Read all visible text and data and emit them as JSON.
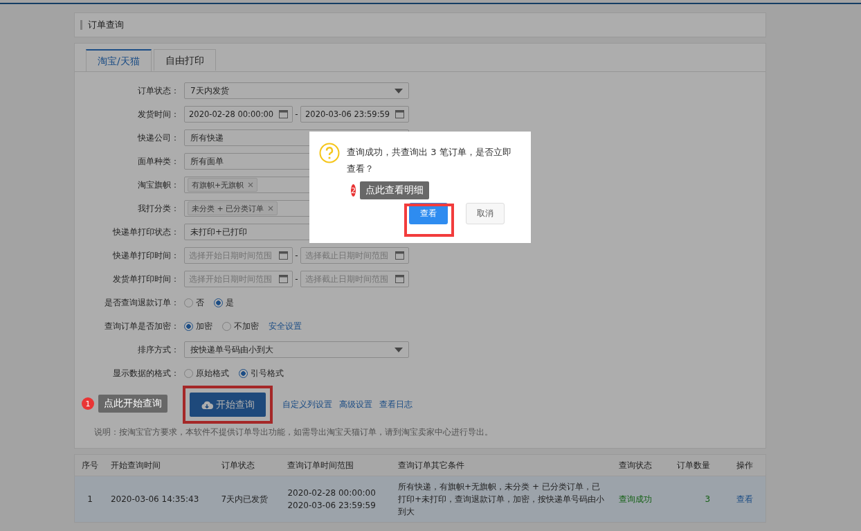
{
  "page_title": "订单查询",
  "tabs": [
    {
      "label": "淘宝/天猫",
      "selected": true
    },
    {
      "label": "自由打印",
      "selected": false
    }
  ],
  "form": {
    "rows": [
      {
        "label": "订单状态：",
        "kind": "select",
        "value": "7天内发货"
      },
      {
        "label": "发货时间：",
        "kind": "date_range",
        "start": {
          "value": "2020-02-28 00:00:00"
        },
        "separator": "-",
        "end": {
          "value": "2020-03-06 23:59:59"
        }
      },
      {
        "label": "快递公司：",
        "kind": "select",
        "value": "所有快递"
      },
      {
        "label": "面单种类：",
        "kind": "select",
        "value": "所有面单"
      },
      {
        "label": "淘宝旗帜：",
        "kind": "tags",
        "tags": [
          "有旗帜+无旗帜"
        ]
      },
      {
        "label": "我打分类：",
        "kind": "tags",
        "tags": [
          "未分类 + 已分类订单"
        ]
      },
      {
        "label": "快递单打印状态：",
        "kind": "select",
        "value": "未打印+已打印"
      },
      {
        "label": "快递单打印时间：",
        "kind": "date_range",
        "start": {
          "placeholder": "选择开始日期时间范围"
        },
        "separator": "-",
        "end": {
          "placeholder": "选择截止日期时间范围"
        }
      },
      {
        "label": "发货单打印时间：",
        "kind": "date_range",
        "start": {
          "placeholder": "选择开始日期时间范围"
        },
        "separator": "-",
        "end": {
          "placeholder": "选择截止日期时间范围"
        }
      },
      {
        "label": "是否查询退款订单：",
        "kind": "radio",
        "options": [
          {
            "label": "否",
            "selected": false
          },
          {
            "label": "是",
            "selected": true
          }
        ]
      },
      {
        "label": "查询订单是否加密：",
        "kind": "radio",
        "options": [
          {
            "label": "加密",
            "selected": true
          },
          {
            "label": "不加密",
            "selected": false
          }
        ],
        "link": "安全设置"
      },
      {
        "label": "排序方式：",
        "kind": "select",
        "value": "按快递单号码由小到大"
      },
      {
        "label": "显示数据的格式：",
        "kind": "radio",
        "options": [
          {
            "label": "原始格式",
            "selected": false
          },
          {
            "label": "引号格式",
            "selected": true
          }
        ]
      }
    ],
    "search_button": "开始查询",
    "links": [
      "自定义列设置",
      "高级设置",
      "查看日志"
    ],
    "note": "说明：按淘宝官方要求，本软件不提供订单导出功能，如需导出淘宝天猫订单，请到淘宝卖家中心进行导出。"
  },
  "table": {
    "columns": [
      {
        "label": "序号",
        "kind": "index"
      },
      {
        "label": "开始查询时间",
        "kind": "text"
      },
      {
        "label": "订单状态",
        "kind": "text"
      },
      {
        "label": "查询订单时间范围",
        "kind": "text"
      },
      {
        "label": "查询订单其它条件",
        "kind": "text"
      },
      {
        "label": "查询状态",
        "kind": "success"
      },
      {
        "label": "订单数量",
        "kind": "number"
      },
      {
        "label": "操作",
        "kind": "link"
      }
    ],
    "rows": [
      {
        "selected": true,
        "cells": [
          "1",
          "2020-03-06 14:35:43",
          "7天内已发货",
          "2020-02-28 00:00:00\n2020-03-06 23:59:59",
          "所有快递，有旗帜+无旗帜，未分类 + 已分类订单，已打印+未打印，查询退款订单，加密，按快递单号码由小到大",
          "查询成功",
          "3",
          "查看"
        ]
      }
    ]
  },
  "dialog": {
    "message": "查询成功，共查询出 3 笔订单，是否立即查看？",
    "buttons": [
      {
        "label": "查看",
        "kind": "primary"
      },
      {
        "label": "取消",
        "kind": "default"
      }
    ]
  },
  "callouts": [
    {
      "number": "1",
      "text": "点此开始查询"
    },
    {
      "number": "2",
      "text": "点此查看明细"
    }
  ]
}
